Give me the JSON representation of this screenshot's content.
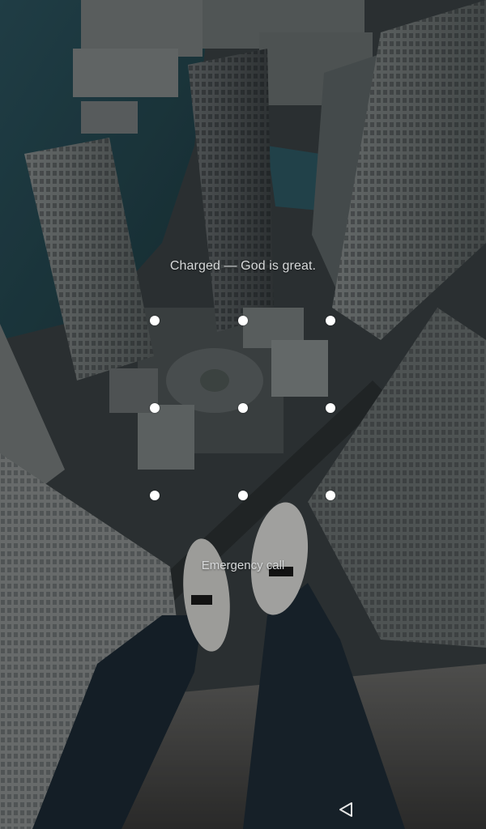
{
  "lockscreen": {
    "status_message": "Charged — God is great.",
    "emergency_call_label": "Emergency call"
  },
  "pattern": {
    "rows": 3,
    "columns": 3,
    "dot_color": "#ffffff"
  },
  "navigation": {
    "back_icon": "back-triangle-icon"
  },
  "colors": {
    "text": "#d7d9da",
    "background": "#1d2327"
  }
}
